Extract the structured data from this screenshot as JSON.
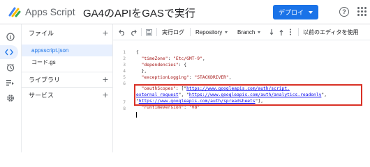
{
  "header": {
    "app_name": "Apps Script",
    "project_title": "GA4のAPIをGASで実行",
    "deploy_label": "デプロイ",
    "help_symbol": "?"
  },
  "panel": {
    "files_label": "ファイル",
    "files": [
      "appsscript.json",
      "コード.gs"
    ],
    "libraries_label": "ライブラリ",
    "services_label": "サービス"
  },
  "toolbar": {
    "exec_log": "実行ログ",
    "repository": "Repository",
    "branch": "Branch",
    "older_editor": "以前のエディタを使用"
  },
  "editor": {
    "line_numbers": [
      "1",
      "2",
      "3",
      "4",
      "5",
      "6",
      "",
      "7",
      "8"
    ],
    "lines": {
      "l1": "{",
      "l2_key": "\"timeZone\"",
      "l2_val": "\"Etc/GMT-9\"",
      "l3_key": "\"dependencies\"",
      "l4": "},",
      "l5_key": "\"exceptionLogging\"",
      "l5_val": "\"STACKDRIVER\"",
      "l6_key": "\"oauthScopes\"",
      "l6_url1a": "https://www.googleapis.com/auth/script.",
      "l6_url1b": "external_request",
      "l6_url2": "https://www.googleapis.com/auth/analytics.readonly",
      "l6_url3": "https://www.googleapis.com/auth/spreadsheets",
      "l7_key": "\"runtimeVersion\"",
      "l7_val": "\"V8\""
    }
  },
  "colors": {
    "accent": "#1a73e8",
    "highlight": "#d93025",
    "string": "#a31515"
  }
}
